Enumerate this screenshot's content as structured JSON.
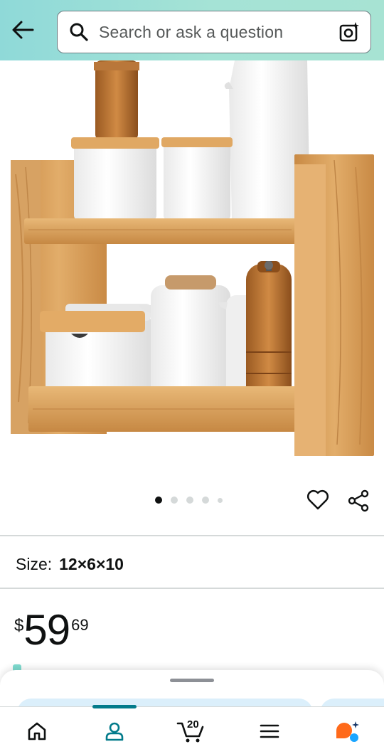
{
  "search": {
    "placeholder": "Search or ask a question"
  },
  "product": {
    "image_count": 5,
    "active_image_index": 0,
    "size_label": "Size:",
    "size_value": "12×6×10",
    "price_symbol": "$",
    "price_whole": "59",
    "price_fraction": "69"
  },
  "bottom_nav": {
    "items": [
      {
        "name": "home",
        "icon": "home-icon"
      },
      {
        "name": "you",
        "icon": "user-icon",
        "active": true
      },
      {
        "name": "cart",
        "icon": "cart-icon"
      },
      {
        "name": "menu",
        "icon": "menu-icon"
      },
      {
        "name": "rufus",
        "icon": "rufus-icon"
      }
    ],
    "cart_count": "20"
  },
  "colors": {
    "header_gradient_start": "#8fd9d8",
    "header_gradient_end": "#a7e3d3",
    "active_nav": "#037b8b",
    "wood": "#d9a05b",
    "rufus_orange": "#ff6a1a",
    "rufus_blue": "#1aa5ff"
  }
}
